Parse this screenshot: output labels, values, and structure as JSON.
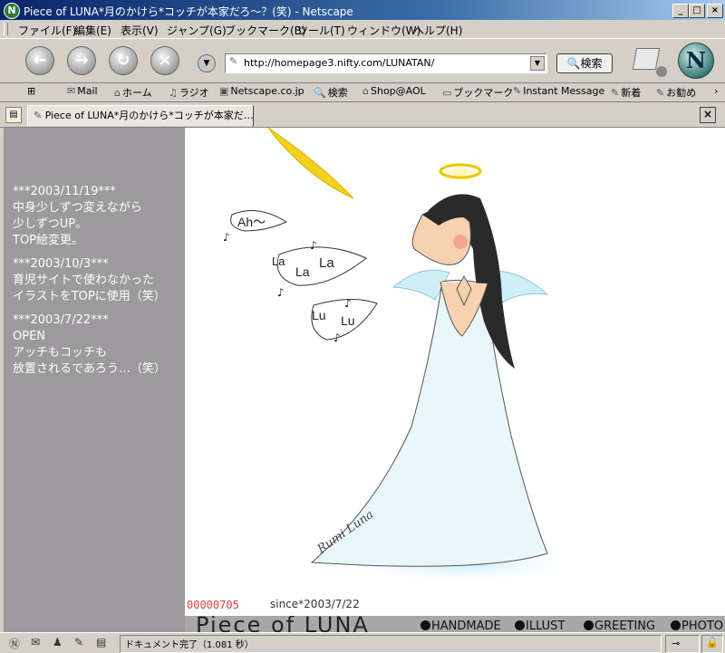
{
  "window": {
    "title": "Piece of LUNA*月のかけら*コッチが本家だろ～？(笑) - Netscape",
    "title_icon": "netscape-n-icon",
    "controls": [
      "_",
      "□",
      "×"
    ]
  },
  "menu": [
    "ファイル(F)",
    "編集(E)",
    "表示(V)",
    "ジャンプ(G)",
    "ブックマーク(B)",
    "ツール(T)",
    "ウィンドウ(W)",
    "ヘルプ(H)"
  ],
  "nav": {
    "back_icon": "back-arrow-icon",
    "forward_icon": "forward-arrow-icon",
    "reload_icon": "reload-icon",
    "stop_icon": "stop-icon",
    "url": "http://homepage3.nifty.com/LUNATAN/",
    "search_label": "検索",
    "logo_letter": "N"
  },
  "personal_toolbar": [
    "Mail",
    "ホーム",
    "ラジオ",
    "Netscape.co.jp",
    "検索",
    "Shop@AOL",
    "ブックマーク",
    "Instant Message",
    "新着",
    "お勧め"
  ],
  "tab": {
    "label": "Piece of LUNA*月のかけら*コッチが本家だ…"
  },
  "sidebar": {
    "news": [
      {
        "date": "***2003/11/19***",
        "lines": [
          "中身少しずつ変えながら",
          "少しずつUP。",
          "TOP絵変更。"
        ]
      },
      {
        "date": "***2003/10/3***",
        "lines": [
          "育児サイトで使わなかった",
          "イラストをTOPに使用（笑）"
        ]
      },
      {
        "date": "***2003/7/22***",
        "lines": [
          "OPEN",
          "アッチもコッチも",
          "放置されるであろう…（笑）"
        ]
      }
    ]
  },
  "illustration": {
    "bubble1": "Ah～",
    "bubble2": [
      "La",
      "La",
      "La"
    ],
    "bubble3": [
      "Lu",
      "Lu"
    ],
    "signature": "Rumi Luna"
  },
  "counter": "00000705",
  "since": "since*2003/7/22",
  "footer": {
    "logo": "Piece of LUNA",
    "links": [
      "HANDMADE",
      "ILLUST",
      "GREETING",
      "PHOTO"
    ]
  },
  "status": {
    "text": "ドキュメント完了（1.081 秒）"
  }
}
